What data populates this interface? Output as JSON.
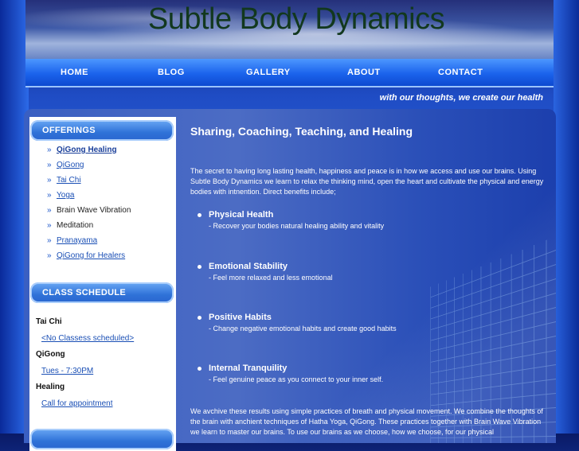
{
  "site": {
    "title": "Subtle Body Dynamics",
    "tagline": "with our thoughts, we create our health"
  },
  "nav": [
    {
      "label": "HOME"
    },
    {
      "label": "BLOG"
    },
    {
      "label": "GALLERY"
    },
    {
      "label": "ABOUT"
    },
    {
      "label": "CONTACT"
    }
  ],
  "sidebar": {
    "offerings_title": "OFFERINGS",
    "offerings": [
      {
        "label": "QiGong Healing",
        "link": true,
        "active": true
      },
      {
        "label": "QiGong",
        "link": true
      },
      {
        "label": "Tai Chi",
        "link": true
      },
      {
        "label": "Yoga",
        "link": true
      },
      {
        "label": "Brain Wave Vibration",
        "link": false
      },
      {
        "label": "Meditation",
        "link": false
      },
      {
        "label": "Pranayama",
        "link": true
      },
      {
        "label": "QiGong for Healers",
        "link": true
      }
    ],
    "schedule_title": "CLASS SCHEDULE",
    "schedule": [
      {
        "heading": "Tai Chi",
        "link": "<No Classess scheduled>"
      },
      {
        "heading": "QiGong",
        "link": "Tues - 7:30PM"
      },
      {
        "heading": "Healing",
        "link": "Call for appointment"
      }
    ]
  },
  "main": {
    "title": "Sharing, Coaching, Teaching, and Healing",
    "intro": "The secret to having long lasting health, happiness and peace is in how we access and use our brains. Using Subtle Body Dynamics we learn to relax the thinking mind, open the heart and cultivate the physical and energy bodies with intnention. Direct benefits include;",
    "benefits": [
      {
        "title": "Physical Health",
        "desc": "- Recover your bodies natural healing ability and vitality"
      },
      {
        "title": "Emotional Stability",
        "desc": "- Feel more relaxed and less emotional"
      },
      {
        "title": "Positive Habits",
        "desc": "- Change negative emotional habits and create good habits"
      },
      {
        "title": "Internal Tranquility",
        "desc": "- Feel genuine peace as you connect to your inner self."
      }
    ],
    "closing": "We avchive these results using simple practices of breath and physical movement. We combine the thoughts of the brain with anchient techniques of Hatha Yoga, QiGong. These practices together with Brain Wave Vibration we learn to master our brains. To use our brains as we choose, how we choose, for our physical"
  }
}
